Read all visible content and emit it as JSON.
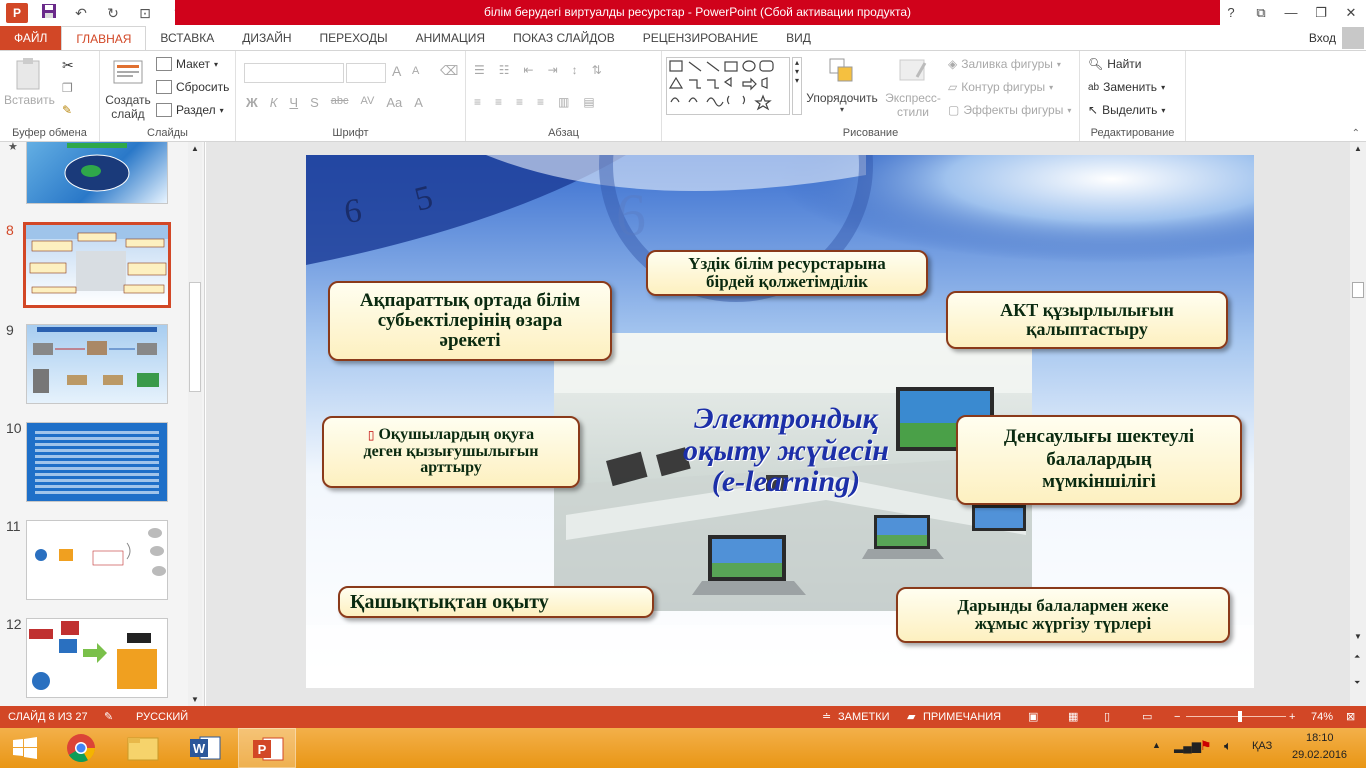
{
  "window": {
    "title": "білім берудегі виртуалды ресурстар - PowerPoint (Сбой активации продукта)"
  },
  "quick_access": [
    "powerpoint-icon",
    "save-icon",
    "undo-icon",
    "redo-icon",
    "start-from-beginning-icon"
  ],
  "window_controls": [
    "?",
    "⧉",
    "—",
    "❐",
    "✕"
  ],
  "tabs": [
    {
      "label": "ФАЙЛ"
    },
    {
      "label": "ГЛАВНАЯ"
    },
    {
      "label": "ВСТАВКА"
    },
    {
      "label": "ДИЗАЙН"
    },
    {
      "label": "ПЕРЕХОДЫ"
    },
    {
      "label": "АНИМАЦИЯ"
    },
    {
      "label": "ПОКАЗ СЛАЙДОВ"
    },
    {
      "label": "РЕЦЕНЗИРОВАНИЕ"
    },
    {
      "label": "ВИД"
    }
  ],
  "signin": "Вход",
  "ribbon": {
    "clipboard": {
      "paste": "Вставить",
      "label": "Буфер обмена"
    },
    "slides": {
      "new_slide_1": "Создать",
      "new_slide_2": "слайд",
      "layout": "Макет",
      "reset": "Сбросить",
      "section": "Раздел",
      "label": "Слайды"
    },
    "font": {
      "label": "Шрифт",
      "bold": "Ж",
      "italic": "К",
      "underline": "Ч",
      "shadow": "S",
      "strike": "abc",
      "spacing": "AV",
      "case": "Aa",
      "color": "A",
      "grow": "A",
      "shrink": "A"
    },
    "paragraph": {
      "label": "Абзац"
    },
    "drawing": {
      "arrange": "Упорядочить",
      "quick_styles_1": "Экспресс-",
      "quick_styles_2": "стили",
      "fill": "Заливка фигуры",
      "outline": "Контур фигуры",
      "effects": "Эффекты фигуры",
      "label": "Рисование"
    },
    "editing": {
      "find": "Найти",
      "replace": "Заменить",
      "select": "Выделить",
      "label": "Редактирование"
    }
  },
  "thumbnails": [
    {
      "num": "",
      "starred": true
    },
    {
      "num": "8",
      "selected": true
    },
    {
      "num": "9"
    },
    {
      "num": "10"
    },
    {
      "num": "11"
    },
    {
      "num": "12"
    }
  ],
  "slide": {
    "boxes": [
      {
        "lines": [
          "Үздік білім ресурстарына",
          "бірдей қолжетімділік"
        ]
      },
      {
        "lines": [
          "Ақпараттық ортада білім",
          "субьектілерінің өзара",
          "әрекеті"
        ]
      },
      {
        "lines": [
          "АКТ құзырлылығын",
          "қалыптастыру"
        ]
      },
      {
        "lines": [
          "Оқушылардың оқуға",
          "деген қызығушылығын",
          "арттыру"
        ],
        "bullet": "▯"
      },
      {
        "lines": [
          "Денсаулығы шектеулі",
          "балалардың",
          "мүмкіншілігі"
        ]
      },
      {
        "lines": [
          "Қашықтықтан оқыту"
        ]
      },
      {
        "lines": [
          "Дарынды балалармен жеке",
          "жұмыс жүргізу түрлері"
        ]
      }
    ],
    "center_title": [
      "Электрондық",
      "оқыту жүйесін",
      "(e-learning)"
    ]
  },
  "status": {
    "slide_info": "СЛАЙД 8 ИЗ 27",
    "language": "РУССКИЙ",
    "notes": "ЗАМЕТКИ",
    "comments": "ПРИМЕЧАНИЯ",
    "zoom": "74%",
    "zoom_fraction": 0.74
  },
  "taskbar": {
    "lang": "ҚАЗ",
    "time": "18:10",
    "date": "29.02.2016"
  },
  "colors": {
    "accent": "#d24726",
    "title_red": "#d0021b",
    "taskbar": "#f0a020",
    "box_border": "#8a3a1a"
  }
}
